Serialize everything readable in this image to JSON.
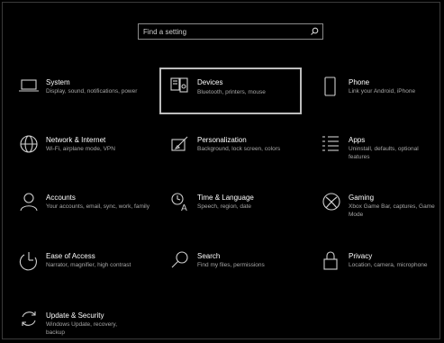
{
  "search": {
    "placeholder": "Find a setting"
  },
  "tiles": [
    {
      "title": "System",
      "desc": "Display, sound, notifications, power",
      "icon": "laptop-icon"
    },
    {
      "title": "Devices",
      "desc": "Bluetooth, printers, mouse",
      "icon": "keyboard-speaker-icon"
    },
    {
      "title": "Phone",
      "desc": "Link your Android, iPhone",
      "icon": "phone-icon"
    },
    {
      "title": "Network & Internet",
      "desc": "Wi-Fi, airplane mode, VPN",
      "icon": "globe-icon"
    },
    {
      "title": "Personalization",
      "desc": "Background, lock screen, colors",
      "icon": "brush-icon"
    },
    {
      "title": "Apps",
      "desc": "Uninstall, defaults, optional features",
      "icon": "apps-list-icon"
    },
    {
      "title": "Accounts",
      "desc": "Your accounts, email, sync, work, family",
      "icon": "person-icon"
    },
    {
      "title": "Time & Language",
      "desc": "Speech, region, date",
      "icon": "time-language-icon"
    },
    {
      "title": "Gaming",
      "desc": "Xbox Game Bar, captures, Game Mode",
      "icon": "xbox-icon"
    },
    {
      "title": "Ease of Access",
      "desc": "Narrator, magnifier, high contrast",
      "icon": "ease-of-access-icon"
    },
    {
      "title": "Search",
      "desc": "Find my files, permissions",
      "icon": "search-icon"
    },
    {
      "title": "Privacy",
      "desc": "Location, camera, microphone",
      "icon": "lock-icon"
    },
    {
      "title": "Update & Security",
      "desc": "Windows Update, recovery, backup",
      "icon": "sync-icon"
    }
  ]
}
